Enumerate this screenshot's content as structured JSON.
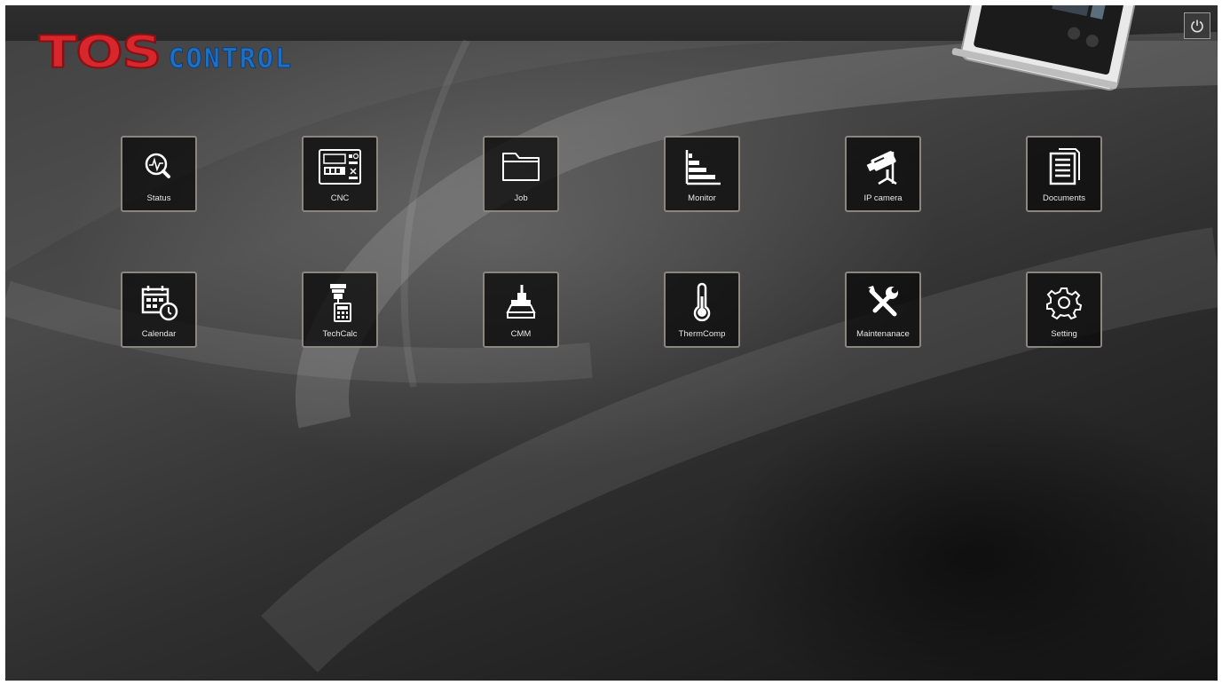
{
  "brand": {
    "logo_main": "TOS",
    "logo_sub": "CONTROL"
  },
  "header": {
    "power_icon": "power-icon"
  },
  "tiles": [
    {
      "label": "Status",
      "icon": "status-icon"
    },
    {
      "label": "CNC",
      "icon": "cnc-panel-icon"
    },
    {
      "label": "Job",
      "icon": "folder-icon"
    },
    {
      "label": "Monitor",
      "icon": "bar-chart-icon"
    },
    {
      "label": "IP camera",
      "icon": "camera-icon"
    },
    {
      "label": "Documents",
      "icon": "documents-icon"
    },
    {
      "label": "Calendar",
      "icon": "calendar-icon"
    },
    {
      "label": "TechCalc",
      "icon": "calculator-icon"
    },
    {
      "label": "CMM",
      "icon": "cmm-icon"
    },
    {
      "label": "ThermComp",
      "icon": "thermometer-icon"
    },
    {
      "label": "Maintenanace",
      "icon": "tools-icon"
    },
    {
      "label": "Setting",
      "icon": "gear-icon"
    }
  ],
  "colors": {
    "brand_red": "#d7262c",
    "brand_blue": "#1f6fc4",
    "tile_border": "#8c8680"
  }
}
